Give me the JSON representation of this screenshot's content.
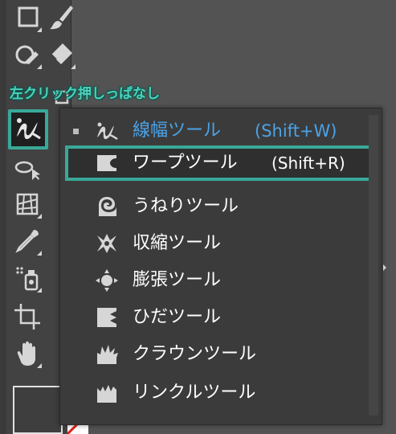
{
  "annotation": {
    "text": "左クリック押しっぱなし"
  },
  "toolbar": {
    "tools": [
      {
        "name": "rectangle-tool",
        "icon": "rectangle-icon"
      },
      {
        "name": "paintbrush-tool",
        "icon": "paintbrush-icon"
      },
      {
        "name": "shaper-tool",
        "icon": "shaper-icon"
      },
      {
        "name": "eraser-tool",
        "icon": "eraser-icon"
      },
      {
        "name": "width-tool",
        "icon": "width-tool-icon",
        "active": true
      },
      {
        "name": "free-transform-tool",
        "icon": "free-transform-icon"
      },
      {
        "name": "perspective-grid-tool",
        "icon": "perspective-grid-icon"
      },
      {
        "name": "eyedropper-tool",
        "icon": "eyedropper-icon"
      },
      {
        "name": "symbol-sprayer-tool",
        "icon": "symbol-sprayer-icon"
      },
      {
        "name": "artboard-tool",
        "icon": "artboard-icon"
      },
      {
        "name": "hand-tool",
        "icon": "hand-icon"
      }
    ]
  },
  "flyout": {
    "items": [
      {
        "label": "線幅ツール",
        "shortcut": "(Shift+W)",
        "icon": "width-tool-icon",
        "current": true
      },
      {
        "label": "ワープツール",
        "shortcut": "(Shift+R)",
        "icon": "warp-icon",
        "hover": true
      },
      {
        "label": "うねりツール",
        "shortcut": "",
        "icon": "twirl-icon"
      },
      {
        "label": "収縮ツール",
        "shortcut": "",
        "icon": "pucker-icon"
      },
      {
        "label": "膨張ツール",
        "shortcut": "",
        "icon": "bloat-icon"
      },
      {
        "label": "ひだツール",
        "shortcut": "",
        "icon": "scallop-icon"
      },
      {
        "label": "クラウンツール",
        "shortcut": "",
        "icon": "crystallize-icon"
      },
      {
        "label": "リンクルツール",
        "shortcut": "",
        "icon": "wrinkle-icon"
      }
    ]
  },
  "colors": {
    "accent_teal": "#3aa899",
    "current_item_blue": "#4ba3e8",
    "annotation_teal": "#4fd1bd"
  }
}
